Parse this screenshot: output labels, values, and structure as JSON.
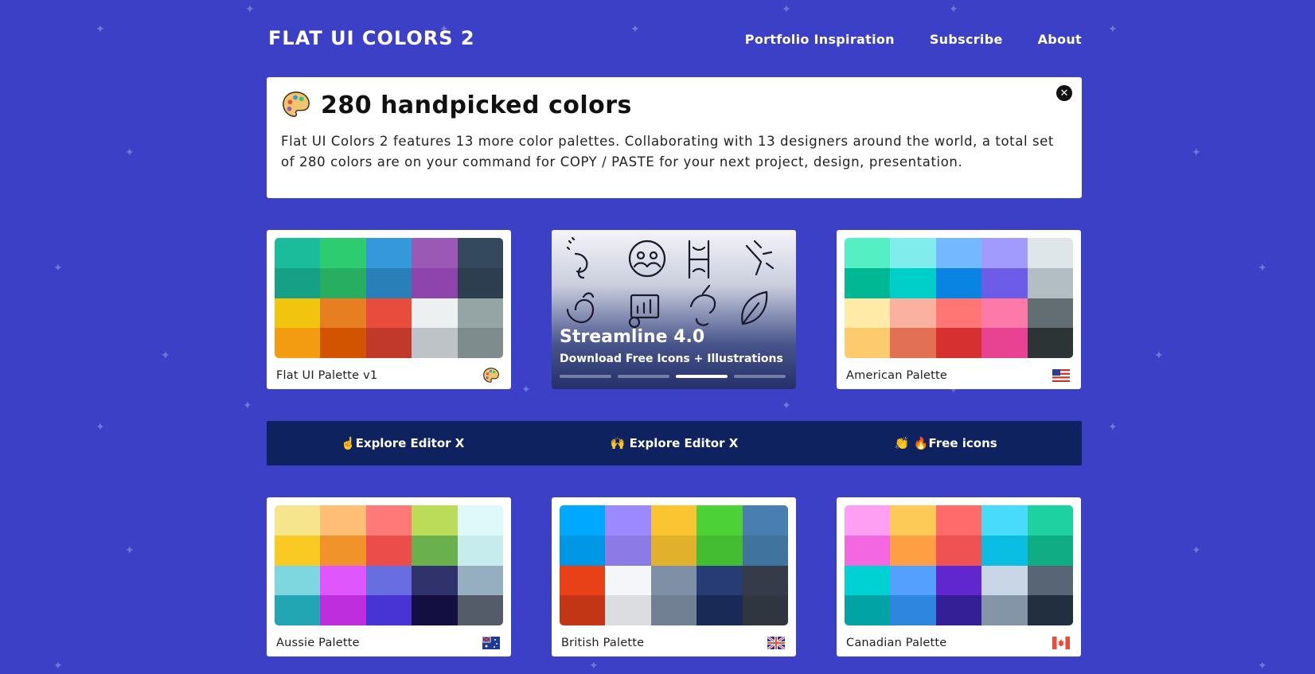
{
  "header": {
    "logo": "FLAT UI COLORS 2",
    "nav": [
      "Portfolio Inspiration",
      "Subscribe",
      "About"
    ]
  },
  "intro": {
    "title": "280 handpicked colors",
    "body": "Flat UI Colors 2 features 13 more color palettes. Collaborating with 13 designers around the world, a total set of 280 colors are on your command for COPY / PASTE for your next project, design, presentation.",
    "close_icon": "close-icon"
  },
  "ad": {
    "title": "Streamline 4.0",
    "subtitle": "Download Free Icons + Illustrations",
    "active_slide": 3,
    "slide_count": 4
  },
  "promo": [
    "☝️Explore Editor X",
    "🙌 Explore Editor X",
    "👏 🔥Free icons"
  ],
  "palettes": [
    {
      "name": "Flat UI Palette v1",
      "flag": "palette-icon",
      "colors": [
        "#1abc9c",
        "#2ecc71",
        "#3498db",
        "#9b59b6",
        "#34495e",
        "#16a085",
        "#27ae60",
        "#2980b9",
        "#8e44ad",
        "#2c3e50",
        "#f1c40f",
        "#e67e22",
        "#e74c3c",
        "#ecf0f1",
        "#95a5a6",
        "#f39c12",
        "#d35400",
        "#c0392b",
        "#bdc3c7",
        "#7f8c8d"
      ]
    },
    {
      "name": "American Palette",
      "flag": "us-flag-icon",
      "colors": [
        "#55efc4",
        "#81ecec",
        "#74b9ff",
        "#a29bfe",
        "#dfe6e9",
        "#00b894",
        "#00cec9",
        "#0984e3",
        "#6c5ce7",
        "#b2bec3",
        "#ffeaa7",
        "#fab1a0",
        "#ff7675",
        "#fd79a8",
        "#636e72",
        "#fdcb6e",
        "#e17055",
        "#d63031",
        "#e84393",
        "#2d3436"
      ]
    },
    {
      "name": "Aussie Palette",
      "flag": "au-flag-icon",
      "colors": [
        "#f6e58d",
        "#ffbe76",
        "#ff7979",
        "#badc58",
        "#dff9fb",
        "#f9ca24",
        "#f0932b",
        "#eb4d4b",
        "#6ab04c",
        "#c7ecee",
        "#7ed6df",
        "#e056fd",
        "#686de0",
        "#30336b",
        "#95afc0",
        "#22a6b3",
        "#be2edd",
        "#4834d4",
        "#130f40",
        "#535c68"
      ]
    },
    {
      "name": "British Palette",
      "flag": "gb-flag-icon",
      "colors": [
        "#00a8ff",
        "#9c88ff",
        "#fbc531",
        "#4cd137",
        "#487eb0",
        "#0097e6",
        "#8c7ae6",
        "#e1b12c",
        "#44bd32",
        "#40739e",
        "#e84118",
        "#f5f6fa",
        "#7f8fa6",
        "#273c75",
        "#353b48",
        "#c23616",
        "#dcdde1",
        "#718093",
        "#192a56",
        "#2f3640"
      ]
    },
    {
      "name": "Canadian Palette",
      "flag": "ca-flag-icon",
      "colors": [
        "#ff9ff3",
        "#feca57",
        "#ff6b6b",
        "#48dbfb",
        "#1dd1a1",
        "#f368e0",
        "#ff9f43",
        "#ee5253",
        "#0abde3",
        "#10ac84",
        "#00d2d3",
        "#54a0ff",
        "#5f27cd",
        "#c8d6e5",
        "#576574",
        "#01a3a4",
        "#2e86de",
        "#341f97",
        "#8395a7",
        "#222f3e"
      ]
    }
  ]
}
